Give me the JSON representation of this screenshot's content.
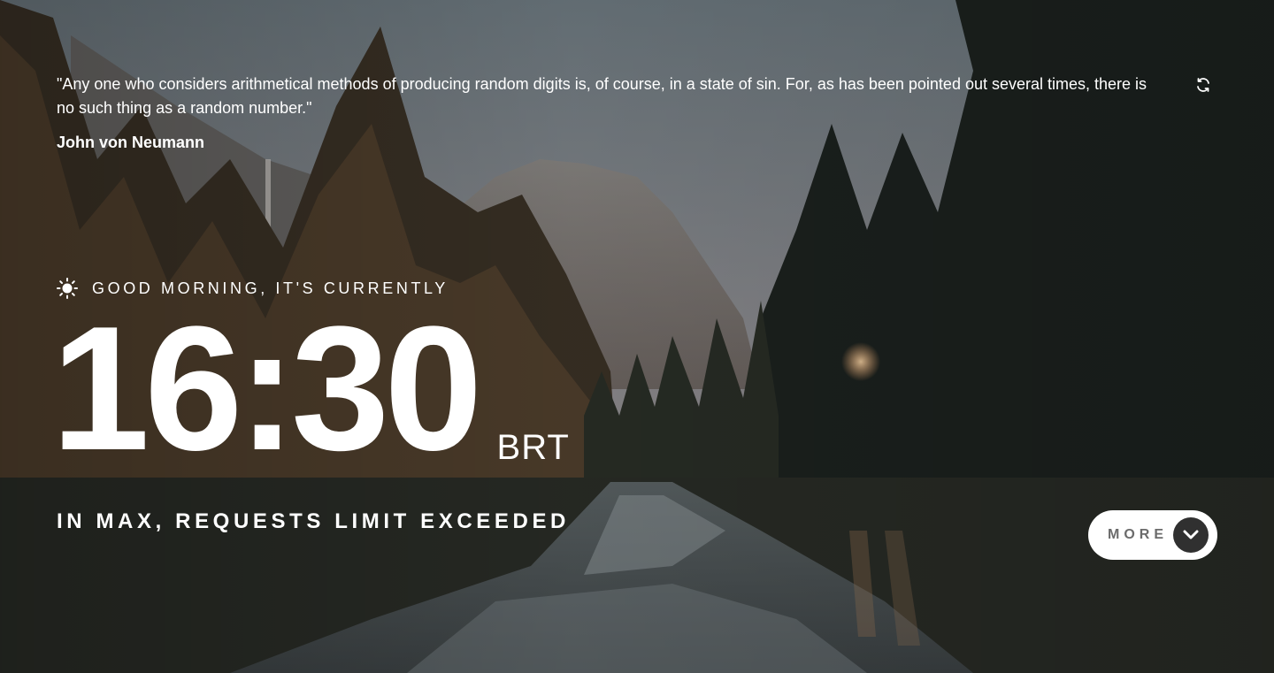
{
  "quote": {
    "text": "\"Any one who considers arithmetical methods of producing random digits is, of course, in a state of sin. For, as has been pointed out several times, there is no such thing as a random number.\"",
    "author": "John von Neumann",
    "refresh_icon": "refresh-icon"
  },
  "greeting": {
    "icon": "sun-icon",
    "text": "GOOD MORNING, IT'S CURRENTLY"
  },
  "clock": {
    "time": "16:30",
    "timezone": "BRT"
  },
  "location": {
    "text": "IN MAX, REQUESTS LIMIT EXCEEDED"
  },
  "more_button": {
    "label": "MORE",
    "icon": "chevron-down-icon"
  },
  "colors": {
    "text": "#ffffff",
    "button_bg": "#ffffff",
    "button_label": "#6b6b6b",
    "arrow_bg": "#303030"
  }
}
